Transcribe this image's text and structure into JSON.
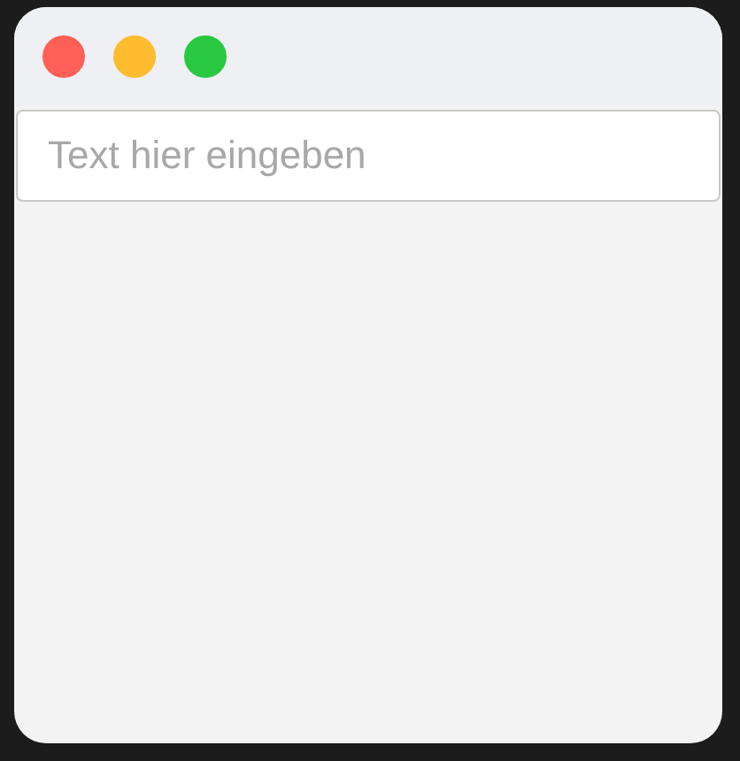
{
  "window": {
    "controls": [
      {
        "color": "#fe5f57"
      },
      {
        "color": "#febc2e"
      },
      {
        "color": "#28c840"
      }
    ]
  },
  "text_field": {
    "placeholder": "Text hier eingeben"
  }
}
